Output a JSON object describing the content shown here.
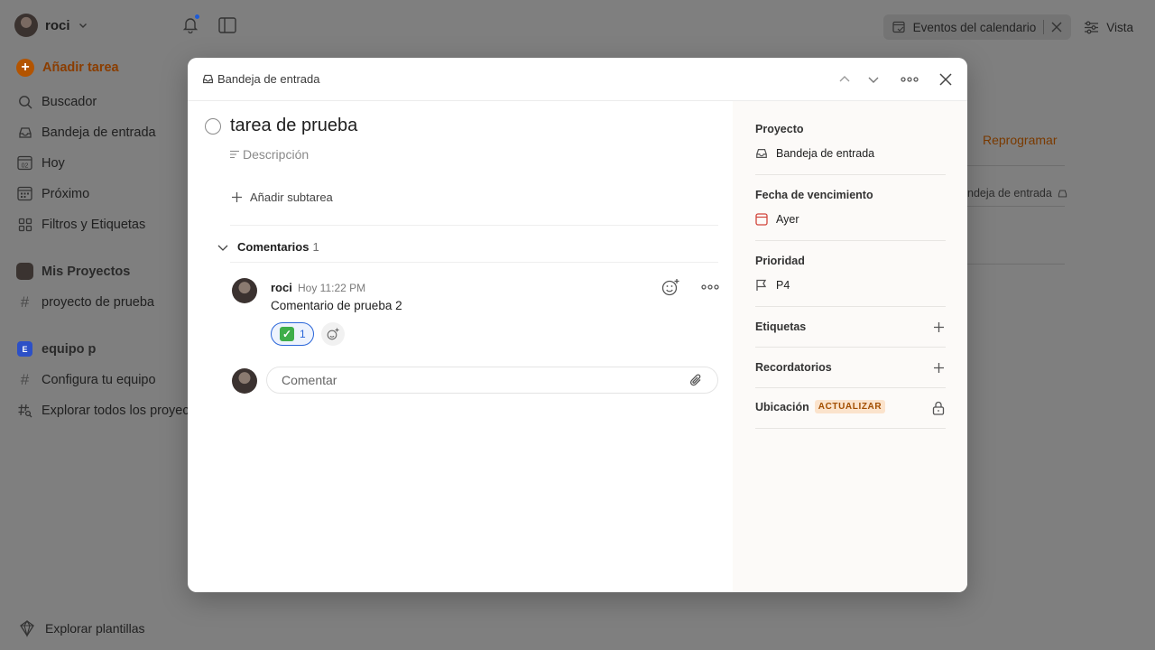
{
  "sidebar": {
    "user_name": "roci",
    "add_task": "Añadir tarea",
    "nav": [
      {
        "label": "Buscador",
        "icon": "search-icon"
      },
      {
        "label": "Bandeja de entrada",
        "icon": "inbox-icon"
      },
      {
        "label": "Hoy",
        "icon": "calendar-today-icon",
        "day": "02"
      },
      {
        "label": "Próximo",
        "icon": "calendar-grid-icon"
      },
      {
        "label": "Filtros y Etiquetas",
        "icon": "filters-icon"
      }
    ],
    "my_projects": "Mis Proyectos",
    "projects": [
      {
        "label": "proyecto de prueba"
      }
    ],
    "team": {
      "badge": "E",
      "label": "equipo p"
    },
    "team_items": [
      {
        "label": "Configura tu equipo"
      },
      {
        "label": "Explorar todos los proyectos"
      }
    ],
    "explore_templates": "Explorar plantillas"
  },
  "topbar": {
    "calendar_events": "Eventos del calendario",
    "view": "Vista"
  },
  "background": {
    "reschedule": "Reprogramar",
    "inbox_fragment": "ndeja de entrada"
  },
  "modal": {
    "breadcrumb": "Bandeja de entrada",
    "task_title": "tarea de prueba",
    "description_placeholder": "Descripción",
    "add_subtask": "Añadir subtarea",
    "comments_label": "Comentarios",
    "comments_count": "1",
    "comment": {
      "author": "roci",
      "time": "Hoy 11:22 PM",
      "text": "Comentario de prueba 2",
      "reaction_count": "1"
    },
    "comment_placeholder": "Comentar"
  },
  "details": {
    "project_label": "Proyecto",
    "project_value": "Bandeja de entrada",
    "due_label": "Fecha de vencimiento",
    "due_value": "Ayer",
    "priority_label": "Prioridad",
    "priority_value": "P4",
    "labels_label": "Etiquetas",
    "reminders_label": "Recordatorios",
    "location_label": "Ubicación",
    "upgrade_badge": "ACTUALIZAR"
  },
  "colors": {
    "accent": "#dc4c3e",
    "overlay_bg": "#7f7f7f",
    "reaction_blue": "#2a66d9",
    "upgrade_text": "#a24e00"
  }
}
